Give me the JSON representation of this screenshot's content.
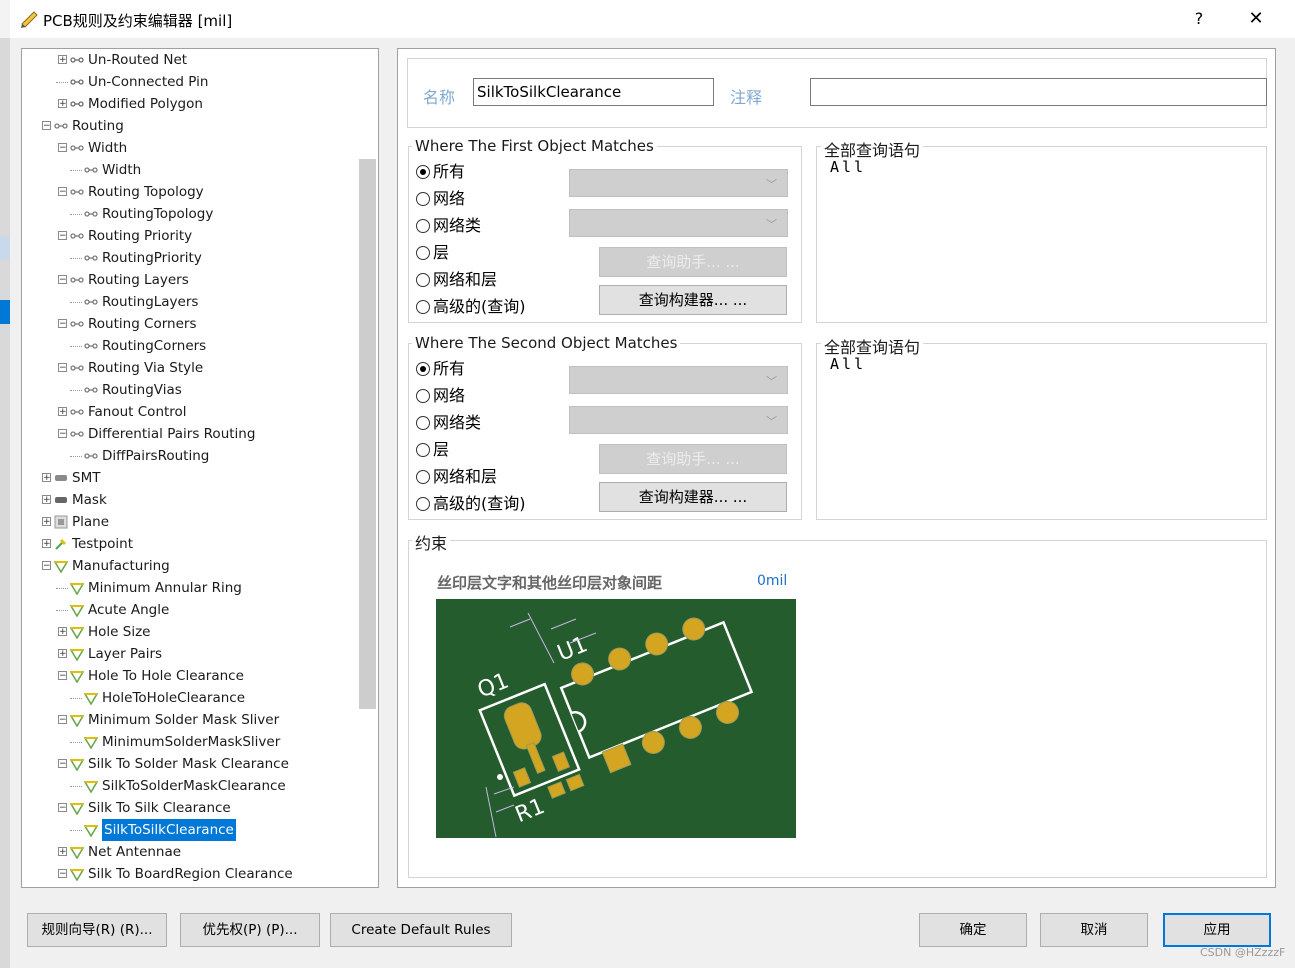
{
  "window": {
    "title": "PCB规则及约束编辑器 [mil]",
    "help": "?",
    "close": "✕"
  },
  "tree": {
    "items": [
      {
        "label": "Un-Routed Net",
        "level": 2,
        "expander": "+",
        "icon": "net-rule-icon"
      },
      {
        "label": "Un-Connected Pin",
        "level": 2,
        "expander": "",
        "icon": "net-rule-icon"
      },
      {
        "label": "Modified Polygon",
        "level": 2,
        "expander": "+",
        "icon": "net-rule-icon"
      },
      {
        "label": "Routing",
        "level": 1,
        "expander": "-",
        "icon": "routing-icon"
      },
      {
        "label": "Width",
        "level": 2,
        "expander": "-",
        "icon": "routing-icon"
      },
      {
        "label": "Width",
        "level": 3,
        "expander": "",
        "icon": "routing-icon"
      },
      {
        "label": "Routing Topology",
        "level": 2,
        "expander": "-",
        "icon": "routing-icon"
      },
      {
        "label": "RoutingTopology",
        "level": 3,
        "expander": "",
        "icon": "routing-icon"
      },
      {
        "label": "Routing Priority",
        "level": 2,
        "expander": "-",
        "icon": "routing-icon"
      },
      {
        "label": "RoutingPriority",
        "level": 3,
        "expander": "",
        "icon": "routing-icon"
      },
      {
        "label": "Routing Layers",
        "level": 2,
        "expander": "-",
        "icon": "routing-icon"
      },
      {
        "label": "RoutingLayers",
        "level": 3,
        "expander": "",
        "icon": "routing-icon"
      },
      {
        "label": "Routing Corners",
        "level": 2,
        "expander": "-",
        "icon": "routing-icon"
      },
      {
        "label": "RoutingCorners",
        "level": 3,
        "expander": "",
        "icon": "routing-icon"
      },
      {
        "label": "Routing Via Style",
        "level": 2,
        "expander": "-",
        "icon": "routing-icon"
      },
      {
        "label": "RoutingVias",
        "level": 3,
        "expander": "",
        "icon": "routing-icon"
      },
      {
        "label": "Fanout Control",
        "level": 2,
        "expander": "+",
        "icon": "routing-icon"
      },
      {
        "label": "Differential Pairs Routing",
        "level": 2,
        "expander": "-",
        "icon": "routing-icon"
      },
      {
        "label": "DiffPairsRouting",
        "level": 3,
        "expander": "",
        "icon": "routing-icon"
      },
      {
        "label": "SMT",
        "level": 1,
        "expander": "+",
        "icon": "smt-icon"
      },
      {
        "label": "Mask",
        "level": 1,
        "expander": "+",
        "icon": "mask-icon"
      },
      {
        "label": "Plane",
        "level": 1,
        "expander": "+",
        "icon": "plane-icon"
      },
      {
        "label": "Testpoint",
        "level": 1,
        "expander": "+",
        "icon": "testpoint-icon"
      },
      {
        "label": "Manufacturing",
        "level": 1,
        "expander": "-",
        "icon": "manufacturing-icon"
      },
      {
        "label": "Minimum Annular Ring",
        "level": 2,
        "expander": "",
        "icon": "manufacturing-icon"
      },
      {
        "label": "Acute Angle",
        "level": 2,
        "expander": "",
        "icon": "manufacturing-icon"
      },
      {
        "label": "Hole Size",
        "level": 2,
        "expander": "+",
        "icon": "manufacturing-icon"
      },
      {
        "label": "Layer Pairs",
        "level": 2,
        "expander": "+",
        "icon": "manufacturing-icon"
      },
      {
        "label": "Hole To Hole Clearance",
        "level": 2,
        "expander": "-",
        "icon": "manufacturing-icon"
      },
      {
        "label": "HoleToHoleClearance",
        "level": 3,
        "expander": "",
        "icon": "manufacturing-icon"
      },
      {
        "label": "Minimum Solder Mask Sliver",
        "level": 2,
        "expander": "-",
        "icon": "manufacturing-icon"
      },
      {
        "label": "MinimumSolderMaskSliver",
        "level": 3,
        "expander": "",
        "icon": "manufacturing-icon"
      },
      {
        "label": "Silk To Solder Mask Clearance",
        "level": 2,
        "expander": "-",
        "icon": "manufacturing-icon"
      },
      {
        "label": "SilkToSolderMaskClearance",
        "level": 3,
        "expander": "",
        "icon": "manufacturing-icon"
      },
      {
        "label": "Silk To Silk Clearance",
        "level": 2,
        "expander": "-",
        "icon": "manufacturing-icon"
      },
      {
        "label": "SilkToSilkClearance",
        "level": 3,
        "expander": "",
        "icon": "manufacturing-icon",
        "selected": true
      },
      {
        "label": "Net Antennae",
        "level": 2,
        "expander": "+",
        "icon": "manufacturing-icon"
      },
      {
        "label": "Silk To BoardRegion Clearance",
        "level": 2,
        "expander": "-",
        "icon": "manufacturing-icon"
      }
    ]
  },
  "rule": {
    "name_label": "名称",
    "name_value": "SilkToSilkClearance",
    "comment_label": "注释",
    "comment_value": ""
  },
  "first_match": {
    "title": "Where The First Object Matches",
    "options": [
      "所有",
      "网络",
      "网络类",
      "层",
      "网络和层",
      "高级的(查询)"
    ],
    "selected": "所有",
    "query_helper": "查询助手... ...",
    "query_builder": "查询构建器... ...",
    "full_query_title": "全部查询语句",
    "full_query": "All"
  },
  "second_match": {
    "title": "Where The Second Object Matches",
    "options": [
      "所有",
      "网络",
      "网络类",
      "层",
      "网络和层",
      "高级的(查询)"
    ],
    "selected": "所有",
    "query_helper": "查询助手... ...",
    "query_builder": "查询构建器... ...",
    "full_query_title": "全部查询语句",
    "full_query": "All"
  },
  "constraints": {
    "title": "约束",
    "label": "丝印层文字和其他丝印层对象间距",
    "value": "0mil",
    "illustration": {
      "q1": "Q1",
      "u1": "U1",
      "r1": "R1",
      "board_color": "#245c2e",
      "pad_color": "#d4a520"
    }
  },
  "footer": {
    "rule_wizard": "规则向导(R) (R)...",
    "priority": "优先权(P) (P)...",
    "create_defaults": "Create Default Rules",
    "ok": "确定",
    "cancel": "取消",
    "apply": "应用"
  },
  "watermark": "CSDN @HZzzzF"
}
